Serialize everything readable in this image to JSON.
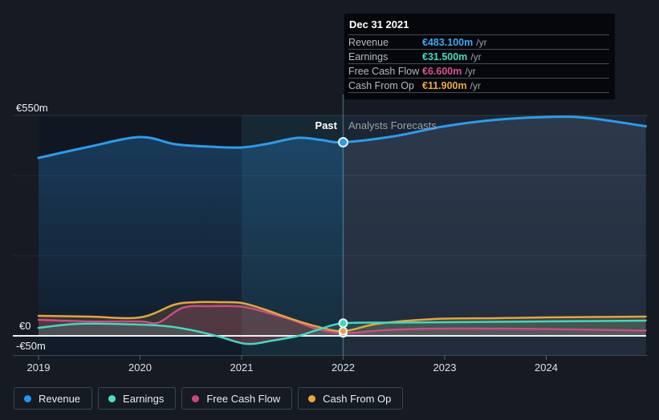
{
  "tooltip": {
    "title": "Dec 31 2021",
    "rows": [
      {
        "label": "Revenue",
        "value": "€483.100m",
        "suffix": "/yr",
        "color": "#3ea6f6"
      },
      {
        "label": "Earnings",
        "value": "€31.500m",
        "suffix": "/yr",
        "color": "#46d8c4"
      },
      {
        "label": "Free Cash Flow",
        "value": "€6.600m",
        "suffix": "/yr",
        "color": "#d65493"
      },
      {
        "label": "Cash From Op",
        "value": "€11.900m",
        "suffix": "/yr",
        "color": "#eaa842"
      }
    ]
  },
  "legend": [
    {
      "label": "Revenue",
      "color": "#2196f3"
    },
    {
      "label": "Earnings",
      "color": "#4ddec5"
    },
    {
      "label": "Free Cash Flow",
      "color": "#c8497f"
    },
    {
      "label": "Cash From Op",
      "color": "#e8a83e"
    }
  ],
  "chart_data": {
    "type": "line",
    "unit": "EUR millions per year",
    "x_ticks": [
      "2019",
      "2020",
      "2021",
      "2022",
      "2023",
      "2024"
    ],
    "ylim": [
      -50,
      550
    ],
    "y_gridlines": [
      550,
      400,
      200,
      0,
      -50
    ],
    "y_axis_labels": [
      "€550m",
      "€0",
      "-€50m"
    ],
    "past_label": "Past",
    "forecast_label": "Analysts Forecasts",
    "divider_year": 2022,
    "highlight_band_years": [
      2021,
      2022
    ],
    "marker_date": "Dec 31 2021",
    "series": [
      {
        "name": "Revenue",
        "color": "#2e9be8",
        "marker_value": 483.1,
        "points": [
          [
            2019,
            444
          ],
          [
            2019.5,
            472
          ],
          [
            2020,
            496
          ],
          [
            2020.35,
            478
          ],
          [
            2020.7,
            472
          ],
          [
            2021,
            470
          ],
          [
            2021.25,
            479
          ],
          [
            2021.55,
            494
          ],
          [
            2021.78,
            489
          ],
          [
            2022,
            483.1
          ],
          [
            2022.5,
            498
          ],
          [
            2023,
            523
          ],
          [
            2023.5,
            539
          ],
          [
            2024,
            546
          ],
          [
            2024.4,
            544
          ],
          [
            2024.98,
            523
          ]
        ]
      },
      {
        "name": "Earnings",
        "color": "#45d6c0",
        "marker_value": 31.5,
        "points": [
          [
            2019,
            20
          ],
          [
            2019.4,
            30
          ],
          [
            2020,
            28
          ],
          [
            2020.3,
            23
          ],
          [
            2020.55,
            12
          ],
          [
            2020.78,
            -2
          ],
          [
            2021.05,
            -20
          ],
          [
            2021.3,
            -12
          ],
          [
            2021.56,
            0
          ],
          [
            2021.75,
            15
          ],
          [
            2022,
            31.5
          ],
          [
            2022.5,
            33
          ],
          [
            2023,
            34
          ],
          [
            2024,
            36
          ],
          [
            2024.98,
            38
          ]
        ]
      },
      {
        "name": "Free Cash Flow",
        "color": "#c84e84",
        "marker_value": 6.6,
        "points": [
          [
            2019,
            40
          ],
          [
            2019.5,
            36
          ],
          [
            2020,
            36
          ],
          [
            2020.18,
            33
          ],
          [
            2020.42,
            70
          ],
          [
            2020.68,
            74
          ],
          [
            2021,
            73
          ],
          [
            2021.25,
            58
          ],
          [
            2021.52,
            38
          ],
          [
            2021.73,
            18
          ],
          [
            2022,
            6.6
          ],
          [
            2022.4,
            14
          ],
          [
            2022.9,
            18
          ],
          [
            2023.5,
            18
          ],
          [
            2024,
            17
          ],
          [
            2024.98,
            13
          ]
        ]
      },
      {
        "name": "Cash From Op",
        "color": "#e5a53e",
        "marker_value": 11.9,
        "points": [
          [
            2019,
            50
          ],
          [
            2019.5,
            48
          ],
          [
            2020,
            46
          ],
          [
            2020.34,
            78
          ],
          [
            2020.56,
            84
          ],
          [
            2020.8,
            84
          ],
          [
            2021,
            82
          ],
          [
            2021.2,
            68
          ],
          [
            2021.47,
            44
          ],
          [
            2021.73,
            24
          ],
          [
            2022,
            11.9
          ],
          [
            2022.34,
            30
          ],
          [
            2022.9,
            42
          ],
          [
            2023.5,
            44
          ],
          [
            2024,
            46
          ],
          [
            2024.98,
            48
          ]
        ]
      }
    ]
  }
}
